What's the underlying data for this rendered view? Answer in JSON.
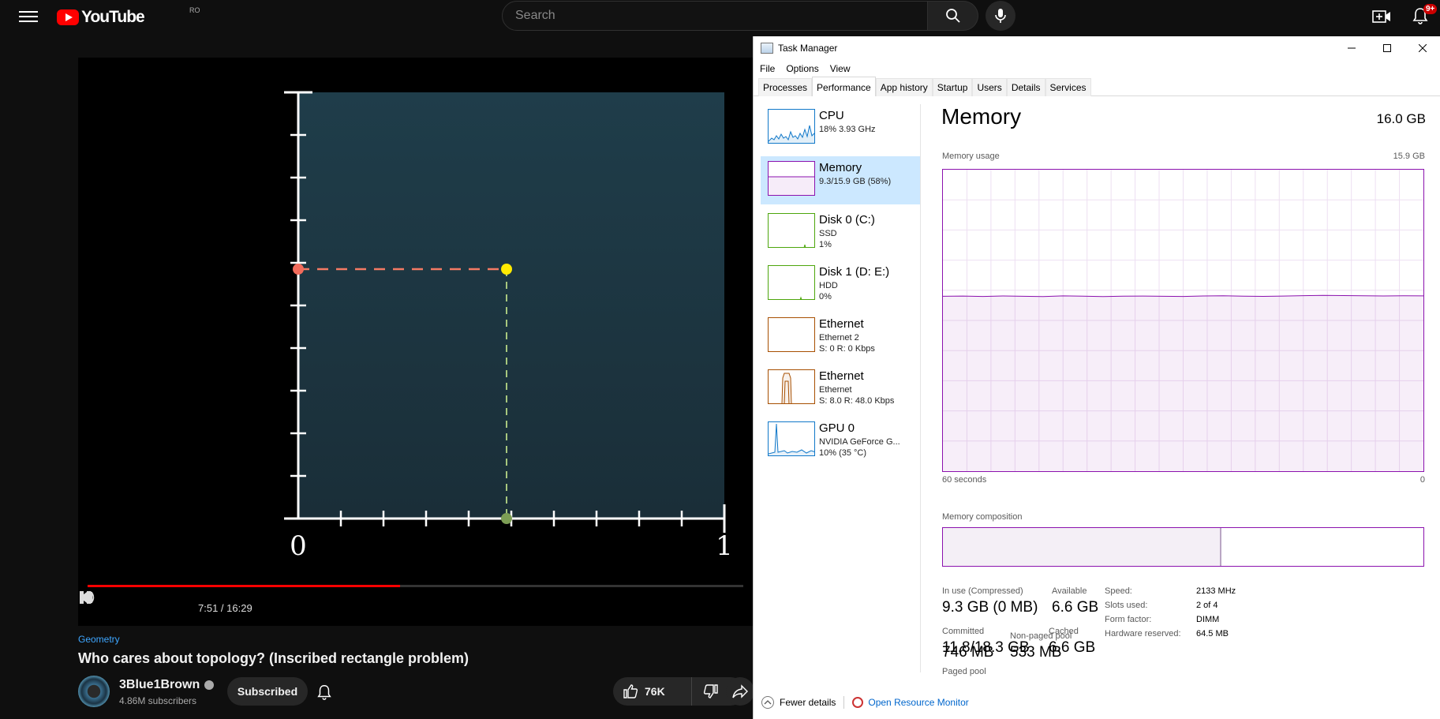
{
  "youtube": {
    "logo_text": "YouTube",
    "country_code": "RO",
    "search_placeholder": "Search",
    "notification_count": "9+",
    "player": {
      "time": "7:51 / 16:29",
      "progress": 0.476,
      "axis_labels": [
        "0",
        "1"
      ]
    },
    "video": {
      "tag": "Geometry",
      "title": "Who cares about topology? (Inscribed rectangle problem)",
      "channel": "3Blue1Brown",
      "subscribers": "4.86M subscribers",
      "subscribe_label": "Subscribed",
      "likes": "76K"
    }
  },
  "task_manager": {
    "window_title": "Task Manager",
    "menu": [
      "File",
      "Options",
      "View"
    ],
    "tabs": [
      "Processes",
      "Performance",
      "App history",
      "Startup",
      "Users",
      "Details",
      "Services"
    ],
    "active_tab": "Performance",
    "sidebar": [
      {
        "name": "CPU",
        "sub1": "18% 3.93 GHz",
        "sub2": "",
        "color": "#1178c9"
      },
      {
        "name": "Memory",
        "sub1": "9.3/15.9 GB (58%)",
        "sub2": "",
        "color": "#8b12ae"
      },
      {
        "name": "Disk 0 (C:)",
        "sub1": "SSD",
        "sub2": "1%",
        "color": "#4da60c"
      },
      {
        "name": "Disk 1 (D: E:)",
        "sub1": "HDD",
        "sub2": "0%",
        "color": "#4da60c"
      },
      {
        "name": "Ethernet",
        "sub1": "Ethernet 2",
        "sub2": "S: 0 R: 0 Kbps",
        "color": "#a74f01"
      },
      {
        "name": "Ethernet",
        "sub1": "Ethernet",
        "sub2": "S: 8.0 R: 48.0 Kbps",
        "color": "#a74f01"
      },
      {
        "name": "GPU 0",
        "sub1": "NVIDIA GeForce G...",
        "sub2": "10% (35 °C)",
        "color": "#1178c9"
      }
    ],
    "memory": {
      "title": "Memory",
      "total": "16.0 GB",
      "usage_label": "Memory usage",
      "usage_max": "15.9 GB",
      "time_left": "60 seconds",
      "time_right": "0",
      "composition_label": "Memory composition",
      "usage_fraction": 0.58,
      "in_use_label": "In use (Compressed)",
      "in_use_value": "9.3 GB (0 MB)",
      "available_label": "Available",
      "available_value": "6.6 GB",
      "committed_label": "Committed",
      "committed_value": "11.8/18.3 GB",
      "cached_label": "Cached",
      "cached_value": "6.6 GB",
      "paged_label": "Paged pool",
      "paged_value": "746 MB",
      "nonpaged_label": "Non-paged pool",
      "nonpaged_value": "533 MB",
      "specs": [
        {
          "label": "Speed:",
          "value": "2133 MHz"
        },
        {
          "label": "Slots used:",
          "value": "2 of 4"
        },
        {
          "label": "Form factor:",
          "value": "DIMM"
        },
        {
          "label": "Hardware reserved:",
          "value": "64.5 MB"
        }
      ]
    },
    "footer": {
      "fewer_details": "Fewer details",
      "open_resource_monitor": "Open Resource Monitor"
    }
  }
}
